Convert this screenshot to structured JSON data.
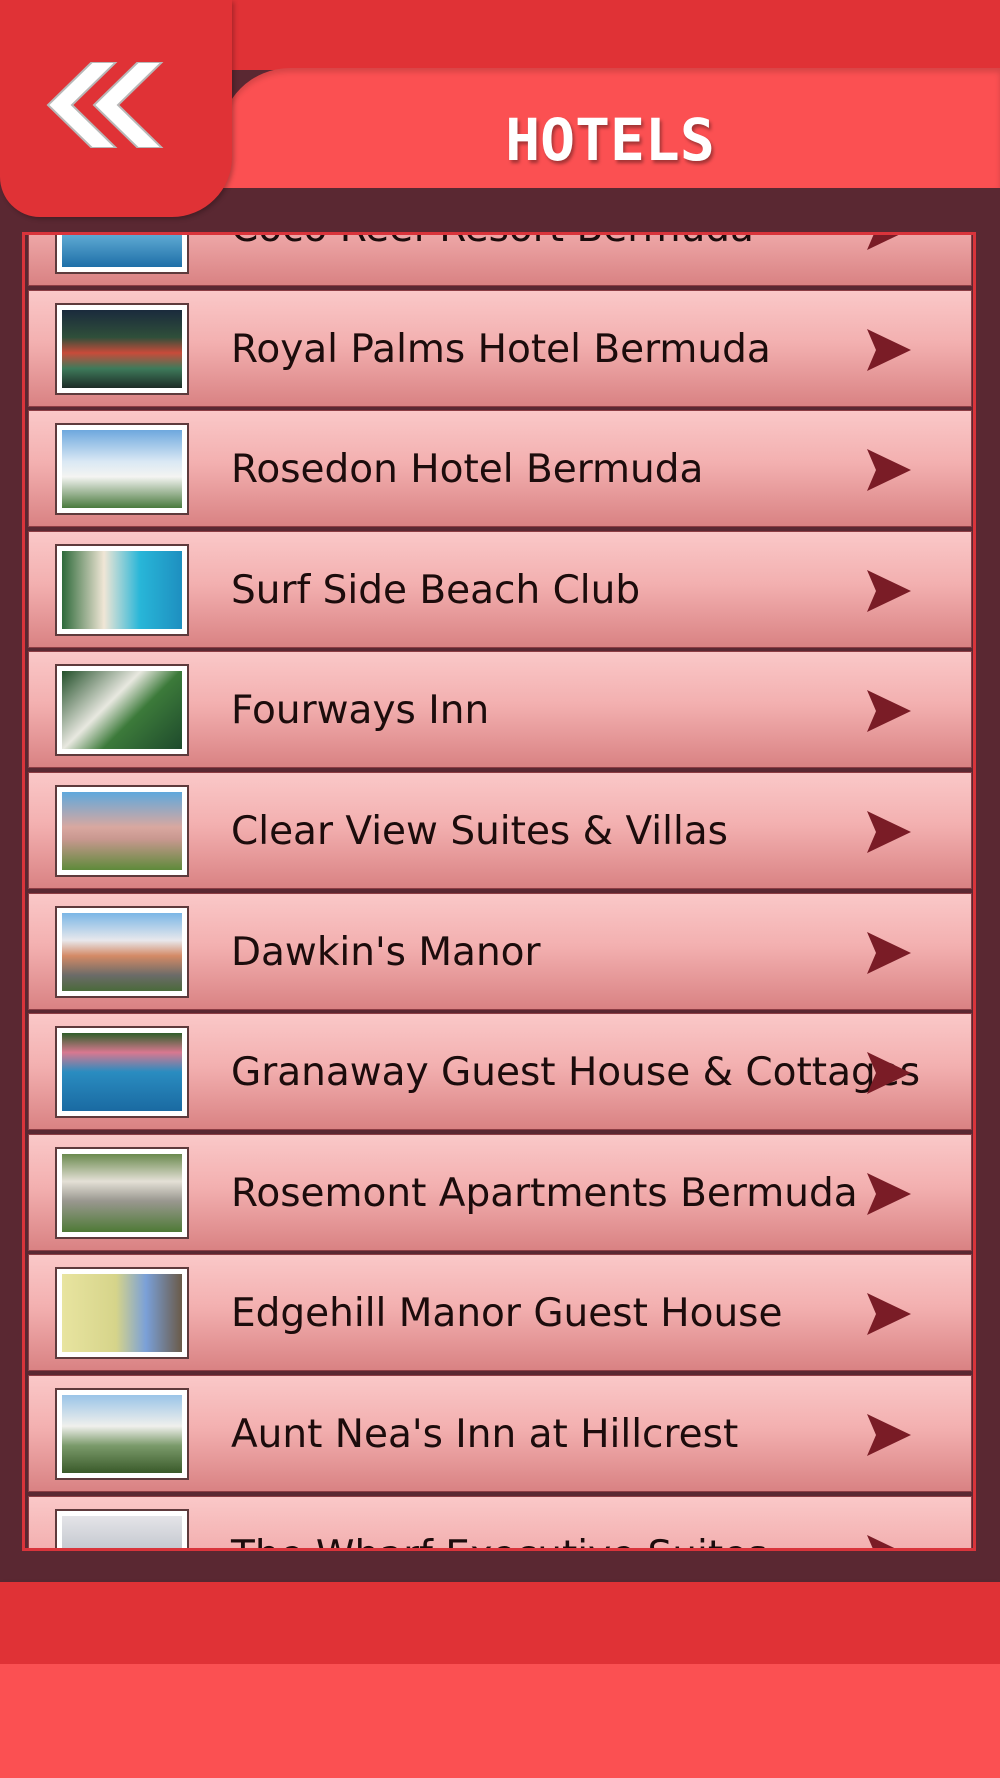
{
  "header": {
    "title": "HOTELS",
    "back_icon": "double-chevron-left-icon"
  },
  "colors": {
    "header_dark": "#e03236",
    "header_light": "#fb5052",
    "background": "#5a2832",
    "row_top": "#fac8c8",
    "row_bottom": "#d98283",
    "arrow": "#7a1c26"
  },
  "hotels": [
    {
      "name": "Coco Reef Resort Bermuda",
      "thumb": "beach-pool-photo"
    },
    {
      "name": "Royal Palms Hotel Bermuda",
      "thumb": "palm-courtyard-photo"
    },
    {
      "name": "Rosedon Hotel Bermuda",
      "thumb": "white-hotel-photo"
    },
    {
      "name": "Surf Side Beach Club",
      "thumb": "seaside-cottages-photo"
    },
    {
      "name": "Fourways Inn",
      "thumb": "aerial-garden-photo"
    },
    {
      "name": "Clear View Suites & Villas",
      "thumb": "pink-villa-photo"
    },
    {
      "name": "Dawkin's Manor",
      "thumb": "manor-driveway-photo"
    },
    {
      "name": "Granaway Guest House & Cottages",
      "thumb": "harbor-boat-photo"
    },
    {
      "name": "Rosemont Apartments Bermuda",
      "thumb": "stone-arch-photo"
    },
    {
      "name": "Edgehill Manor Guest House",
      "thumb": "yellow-manor-photo"
    },
    {
      "name": "Aunt Nea's Inn at Hillcrest",
      "thumb": "white-inn-photo"
    },
    {
      "name": "The Wharf Executive Suites",
      "thumb": "waterfront-building-photo"
    }
  ],
  "row_arrow_icon": "play-arrow-right-icon"
}
